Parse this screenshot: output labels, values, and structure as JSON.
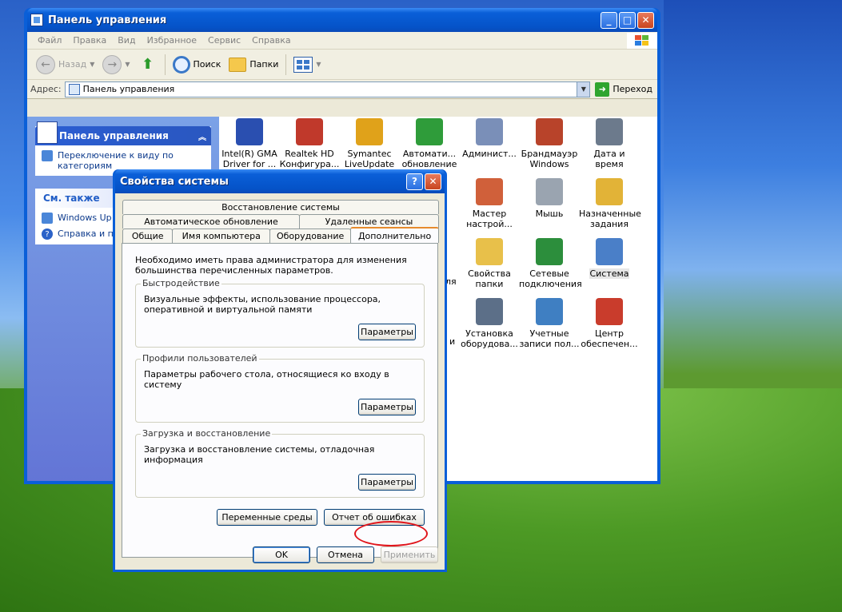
{
  "explorer": {
    "title": "Панель управления",
    "menu": [
      "Файл",
      "Правка",
      "Вид",
      "Избранное",
      "Сервис",
      "Справка"
    ],
    "toolbar": {
      "back": "Назад",
      "search": "Поиск",
      "folders": "Папки"
    },
    "address_label": "Адрес:",
    "address_value": "Панель управления",
    "go_label": "Переход",
    "task_pane": {
      "control_panel_header": "Панель управления",
      "switch_view_link": "Переключение к виду по категориям",
      "see_also_header": "См. также",
      "see_also_links": [
        "Windows Up",
        "Справка и п"
      ]
    },
    "icons": [
      {
        "label": "Intel(R) GMA Driver for ...",
        "color": "#2a4fb0"
      },
      {
        "label": "Realtek HD Конфигура...",
        "color": "#c0392b"
      },
      {
        "label": "Symantec LiveUpdate",
        "color": "#e0a21a"
      },
      {
        "label": "Автомати... обновление",
        "color": "#2f9c3a"
      },
      {
        "label": "Админист...",
        "color": "#7a8fb8"
      },
      {
        "label": "Брандмауэр Windows",
        "color": "#b8432a"
      },
      {
        "label": "Дата и время",
        "color": "#6c7a8c"
      },
      {
        "label": "Мастер настрой...",
        "color": "#d0603a"
      },
      {
        "label": "Мышь",
        "color": "#9aa4b0"
      },
      {
        "label": "Назначенные задания",
        "color": "#e2b337"
      },
      {
        "label": "Свойства папки",
        "color": "#e8c04a"
      },
      {
        "label": "Сетевые подключения",
        "color": "#2c8e3c"
      },
      {
        "label": "Система",
        "color": "#4a7fc8"
      },
      {
        "label": "Установка оборудова...",
        "color": "#5c6f88"
      },
      {
        "label": "Учетные записи пол...",
        "color": "#3f7fc2"
      },
      {
        "label": "Центр обеспечен...",
        "color": "#c93c2c"
      }
    ],
    "peek_labels": [
      "ля",
      "и"
    ]
  },
  "dialog": {
    "title": "Свойства системы",
    "tabs_row1": [
      "Восстановление системы"
    ],
    "tabs_row2": [
      "Автоматическое обновление",
      "Удаленные сеансы"
    ],
    "tabs_row3": [
      "Общие",
      "Имя компьютера",
      "Оборудование",
      "Дополнительно"
    ],
    "intro": "Необходимо иметь права администратора для изменения большинства перечисленных параметров.",
    "groups": [
      {
        "title": "Быстродействие",
        "desc": "Визуальные эффекты, использование процессора, оперативной и виртуальной памяти",
        "button": "Параметры"
      },
      {
        "title": "Профили пользователей",
        "desc": "Параметры рабочего стола, относящиеся ко входу в систему",
        "button": "Параметры"
      },
      {
        "title": "Загрузка и восстановление",
        "desc": "Загрузка и восстановление системы, отладочная информация",
        "button": "Параметры"
      }
    ],
    "env_button": "Переменные среды",
    "error_report_button": "Отчет об ошибках",
    "ok": "OK",
    "cancel": "Отмена",
    "apply": "Применить",
    "help_glyph": "?",
    "close_glyph": "✕"
  }
}
